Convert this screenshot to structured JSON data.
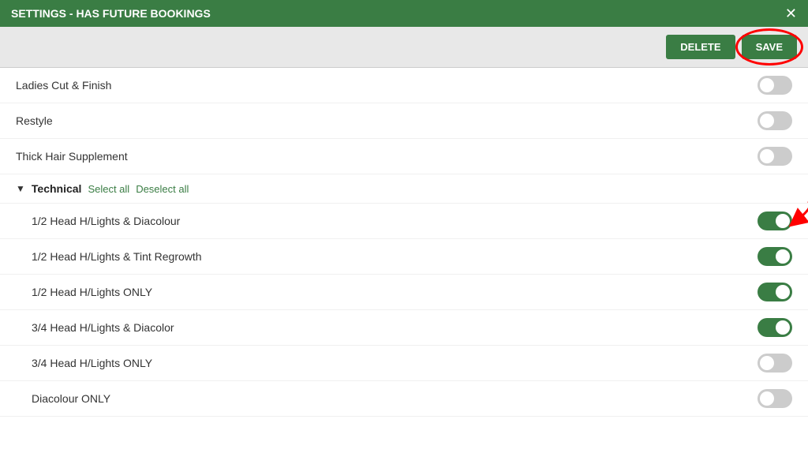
{
  "window": {
    "title": "SETTINGS - HAS FUTURE BOOKINGS"
  },
  "toolbar": {
    "delete_label": "DELETE",
    "save_label": "SAVE"
  },
  "services": [
    {
      "id": "ladies-cut-finish",
      "label": "Ladies Cut & Finish",
      "enabled": false,
      "indented": false
    },
    {
      "id": "restyle",
      "label": "Restyle",
      "enabled": false,
      "indented": false
    },
    {
      "id": "thick-hair",
      "label": "Thick Hair Supplement",
      "enabled": false,
      "indented": false
    }
  ],
  "section": {
    "title": "Technical",
    "select_all_label": "Select all",
    "deselect_all_label": "Deselect all",
    "items": [
      {
        "id": "half-head-diacolour",
        "label": "1/2 Head H/Lights & Diacolour",
        "enabled": true
      },
      {
        "id": "half-head-tint",
        "label": "1/2 Head H/Lights & Tint Regrowth",
        "enabled": true
      },
      {
        "id": "half-head-only",
        "label": "1/2 Head H/Lights ONLY",
        "enabled": true
      },
      {
        "id": "three-quarter-diacolor",
        "label": "3/4 Head H/Lights & Diacolor",
        "enabled": true
      },
      {
        "id": "three-quarter-only",
        "label": "3/4 Head H/Lights ONLY",
        "enabled": false
      },
      {
        "id": "diacolour-only",
        "label": "Diacolour ONLY",
        "enabled": false
      }
    ]
  }
}
